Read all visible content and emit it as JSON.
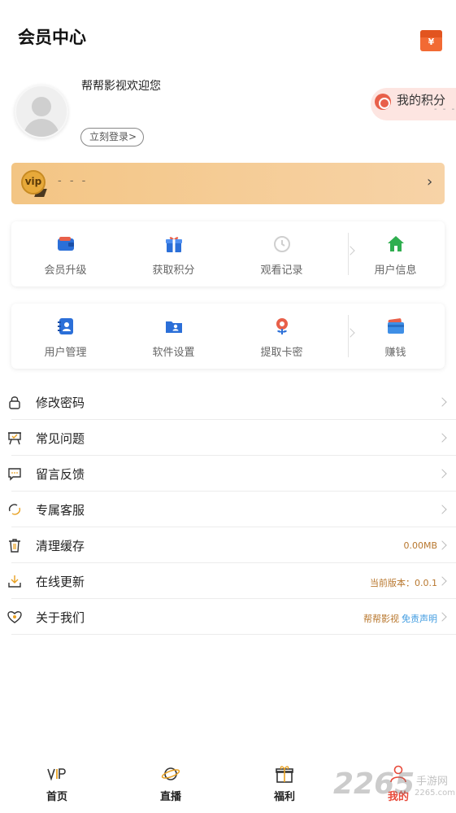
{
  "header": {
    "title": "会员中心",
    "redpacket_icon": "red-envelope-icon"
  },
  "profile": {
    "welcome": "帮帮影视欢迎您",
    "login_label": "立刻登录",
    "login_chevron": ">",
    "points_label": "我的积分",
    "points_value": "- - -"
  },
  "vip": {
    "badge": "vip",
    "status": "- - -",
    "chevron": "›"
  },
  "grid1": [
    {
      "label": "会员升级",
      "icon": "wallet-icon",
      "color": "#2b6fd8"
    },
    {
      "label": "获取积分",
      "icon": "gift-icon",
      "color": "#2b6fd8"
    },
    {
      "label": "观看记录",
      "icon": "history-clock-icon",
      "color": "#cfcfcf"
    },
    {
      "label": "用户信息",
      "icon": "house-icon",
      "color": "#2fae4f"
    }
  ],
  "grid2": [
    {
      "label": "用户管理",
      "icon": "contact-book-icon",
      "color": "#2b6fd8"
    },
    {
      "label": "软件设置",
      "icon": "user-folder-icon",
      "color": "#2b6fd8"
    },
    {
      "label": "提取卡密",
      "icon": "flower-icon",
      "color": "#e8604a"
    },
    {
      "label": "赚钱",
      "icon": "bank-card-icon",
      "color": "#3f8fe6"
    }
  ],
  "menu": [
    {
      "label": "修改密码",
      "icon": "lock-icon",
      "value": "",
      "value2": ""
    },
    {
      "label": "常见问题",
      "icon": "easel-icon",
      "value": "",
      "value2": ""
    },
    {
      "label": "留言反馈",
      "icon": "chat-bubble-icon",
      "value": "",
      "value2": ""
    },
    {
      "label": "专属客服",
      "icon": "headset-icon",
      "value": "",
      "value2": ""
    },
    {
      "label": "清理缓存",
      "icon": "trash-icon",
      "value": "0.00MB",
      "value2": ""
    },
    {
      "label": "在线更新",
      "icon": "download-icon",
      "value": "当前版本：0.0.1",
      "value2": ""
    },
    {
      "label": "关于我们",
      "icon": "heart-badge-icon",
      "value": "帮帮影视",
      "value2": "免责声明"
    }
  ],
  "tabbar": [
    {
      "label": "首页",
      "icon": "vip-icon",
      "active": false
    },
    {
      "label": "直播",
      "icon": "planet-icon",
      "active": false
    },
    {
      "label": "福利",
      "icon": "gift-box-icon",
      "active": false
    },
    {
      "label": "我的",
      "icon": "person-icon",
      "active": true
    }
  ],
  "watermark": {
    "number": "2265",
    "cn": "手游网",
    "url": "2265.com"
  }
}
